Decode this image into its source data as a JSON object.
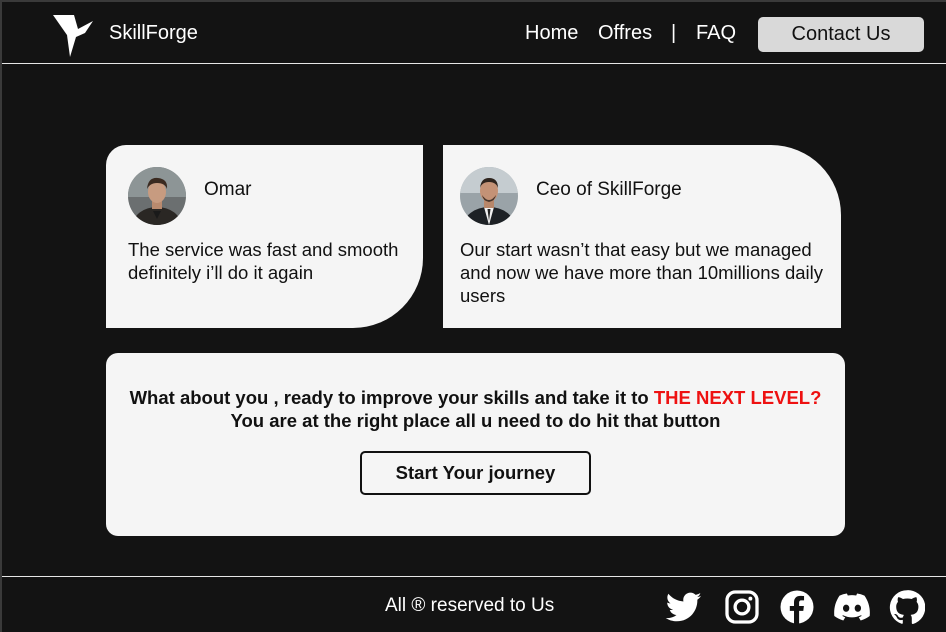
{
  "header": {
    "brand": "SkillForge",
    "nav": {
      "home": "Home",
      "offres": "Offres",
      "separator": "|",
      "faq": "FAQ"
    },
    "contact_label": "Contact Us"
  },
  "testimonials": [
    {
      "name": "Omar",
      "text": "The service was fast and smooth definitely i’ll do it again",
      "avatar_icon": "person-avatar"
    },
    {
      "name": "Ceo of SkillForge",
      "text": "Our start wasn’t that easy but we managed and now we have more than 10millions daily users",
      "avatar_icon": "person-avatar"
    }
  ],
  "cta": {
    "line1_prefix": "What about you , ready to improve your skills and take it to ",
    "line1_highlight": "THE NEXT LEVEL?",
    "line2": "You are at the right place all u need to do hit that button",
    "button_label": "Start Your journey"
  },
  "footer": {
    "text": "All ® reserved to Us",
    "social_icons": [
      "twitter-icon",
      "instagram-icon",
      "facebook-icon",
      "discord-icon",
      "github-icon"
    ]
  },
  "colors": {
    "background": "#131313",
    "card": "#f5f5f5",
    "contact_button": "#d9d9d9",
    "highlight": "#ee1111"
  }
}
